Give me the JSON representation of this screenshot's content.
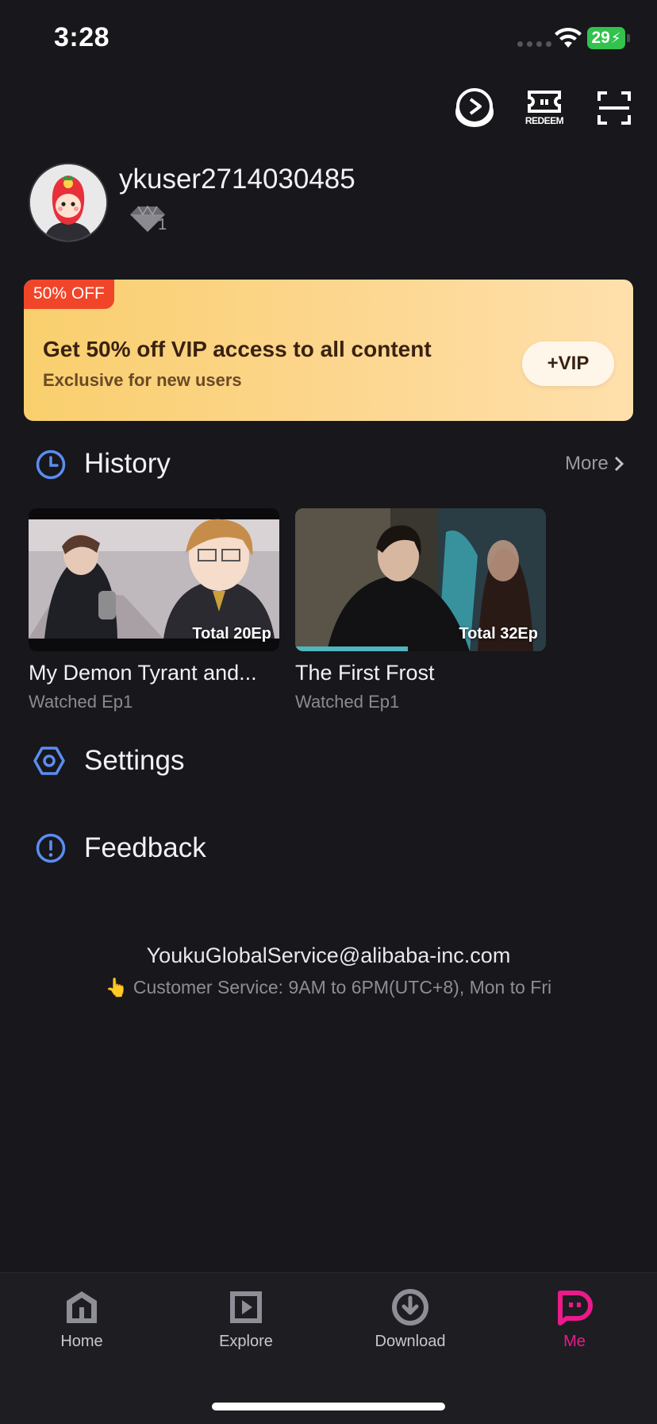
{
  "status_bar": {
    "time": "3:28",
    "battery": "29"
  },
  "header_icons": {
    "redeem_label": "REDEEM"
  },
  "profile": {
    "username": "ykuser2714030485",
    "vip_level": "1"
  },
  "promo": {
    "badge": "50% OFF",
    "title": "Get 50% off VIP access to all content",
    "subtitle": "Exclusive for new users",
    "button_label": "+VIP"
  },
  "history": {
    "title": "History",
    "more_label": "More",
    "items": [
      {
        "title": "My Demon Tyrant and...",
        "watched": "Watched Ep1",
        "total": "Total 20Ep",
        "progress": 0.0
      },
      {
        "title": "The First Frost",
        "watched": "Watched Ep1",
        "total": "Total 32Ep",
        "progress": 0.45
      }
    ]
  },
  "settings": {
    "title": "Settings"
  },
  "feedback": {
    "title": "Feedback"
  },
  "contact": {
    "email": "YoukuGlobalService@alibaba-inc.com",
    "hours": "👆 Customer Service: 9AM to 6PM(UTC+8), Mon to Fri"
  },
  "tabs": [
    {
      "label": "Home",
      "icon": "home-icon"
    },
    {
      "label": "Explore",
      "icon": "play-square-icon"
    },
    {
      "label": "Download",
      "icon": "download-icon"
    },
    {
      "label": "Me",
      "icon": "me-icon"
    }
  ],
  "colors": {
    "background": "#17171c",
    "accent": "#ea1a8a",
    "section_icon": "#5b8df0",
    "progress": "#4fb6bd",
    "promo_badge": "#f1452a"
  }
}
